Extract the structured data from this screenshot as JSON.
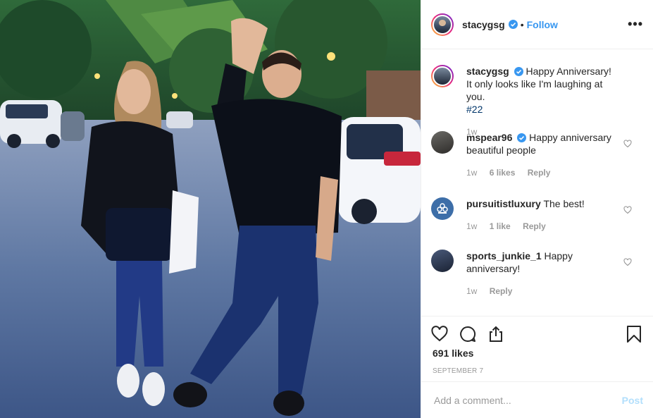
{
  "header": {
    "username": "stacygsg",
    "separator": "•",
    "follow_label": "Follow",
    "more_label": "•••"
  },
  "caption": {
    "username": "stacygsg",
    "text_line1": "Happy Anniversary!",
    "text_line2": "It only looks like I'm laughing at you.",
    "text_line3": "#22",
    "time": "1w"
  },
  "comments": [
    {
      "username": "mspear96",
      "verified": true,
      "text": "Happy anniversary beautiful people",
      "time": "1w",
      "likes": "6 likes",
      "reply": "Reply"
    },
    {
      "username": "pursuitistluxury",
      "verified": false,
      "text": "The best!",
      "time": "1w",
      "likes": "1 like",
      "reply": "Reply"
    },
    {
      "username": "sports_junkie_1",
      "verified": false,
      "text": "Happy anniversary!",
      "time": "1w",
      "likes": "",
      "reply": "Reply"
    }
  ],
  "actions": {
    "like_count": "691 likes",
    "date": "SEPTEMBER 7"
  },
  "add_comment": {
    "placeholder": "Add a comment...",
    "post_label": "Post"
  },
  "colors": {
    "accent": "#3897f0",
    "post_disabled": "#b2dffc"
  },
  "icons": [
    "verified-icon",
    "more-icon",
    "heart-icon",
    "comment-icon",
    "share-icon",
    "bookmark-icon",
    "small-heart-icon"
  ]
}
